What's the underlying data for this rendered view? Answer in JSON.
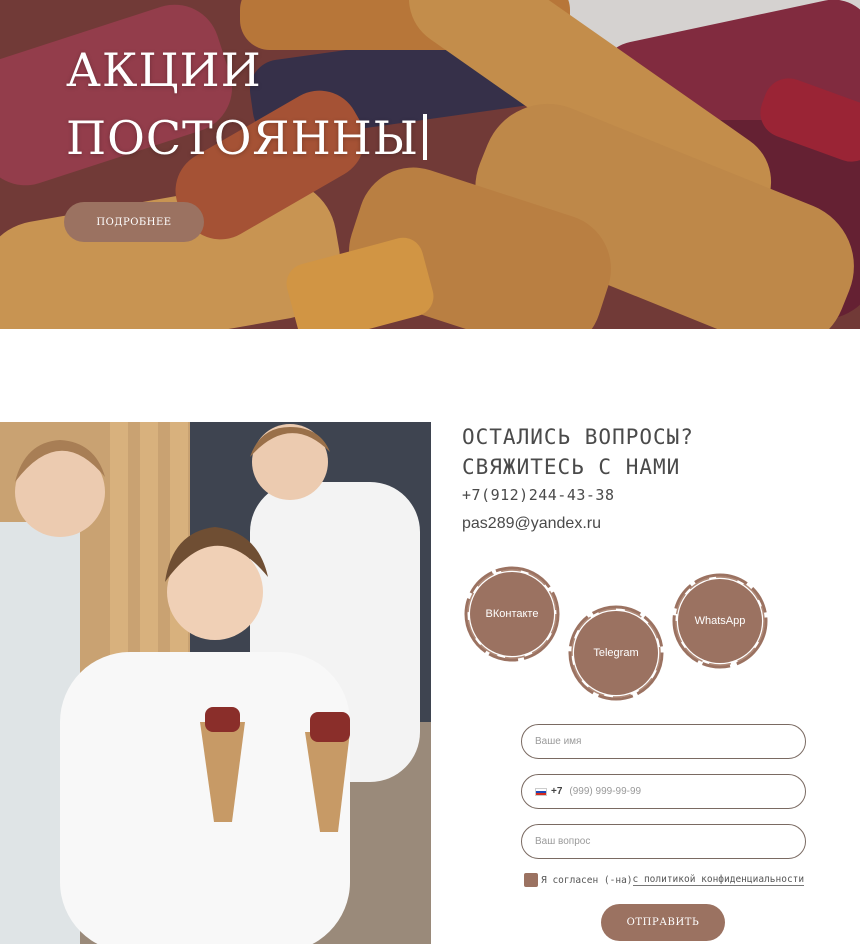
{
  "hero": {
    "title_line1": "АКЦИИ",
    "title_line2": "ПОСТОЯННЫ",
    "button_label": "ПОДРОБНЕЕ"
  },
  "contact": {
    "heading_line1": "ОСТАЛИСЬ ВОПРОСЫ?",
    "heading_line2": "СВЯЖИТЕСЬ С НАМИ",
    "phone": "+7(912)244-43-38",
    "email": "pas289@yandex.ru"
  },
  "social": [
    {
      "label": "ВКонтакте"
    },
    {
      "label": "Telegram"
    },
    {
      "label": "WhatsApp"
    }
  ],
  "form": {
    "name_placeholder": "Ваше имя",
    "phone_code": "+7",
    "phone_placeholder": "(999) 999-99-99",
    "question_placeholder": "Ваш вопрос",
    "consent_text": "Я согласен (-на)",
    "consent_link": "с политикой конфиденциальности",
    "submit_label": "ОТПРАВИТЬ"
  },
  "colors": {
    "accent": "#9b7261",
    "text": "#4a4a4a"
  },
  "icons": {
    "flag": "russia-flag-icon"
  }
}
